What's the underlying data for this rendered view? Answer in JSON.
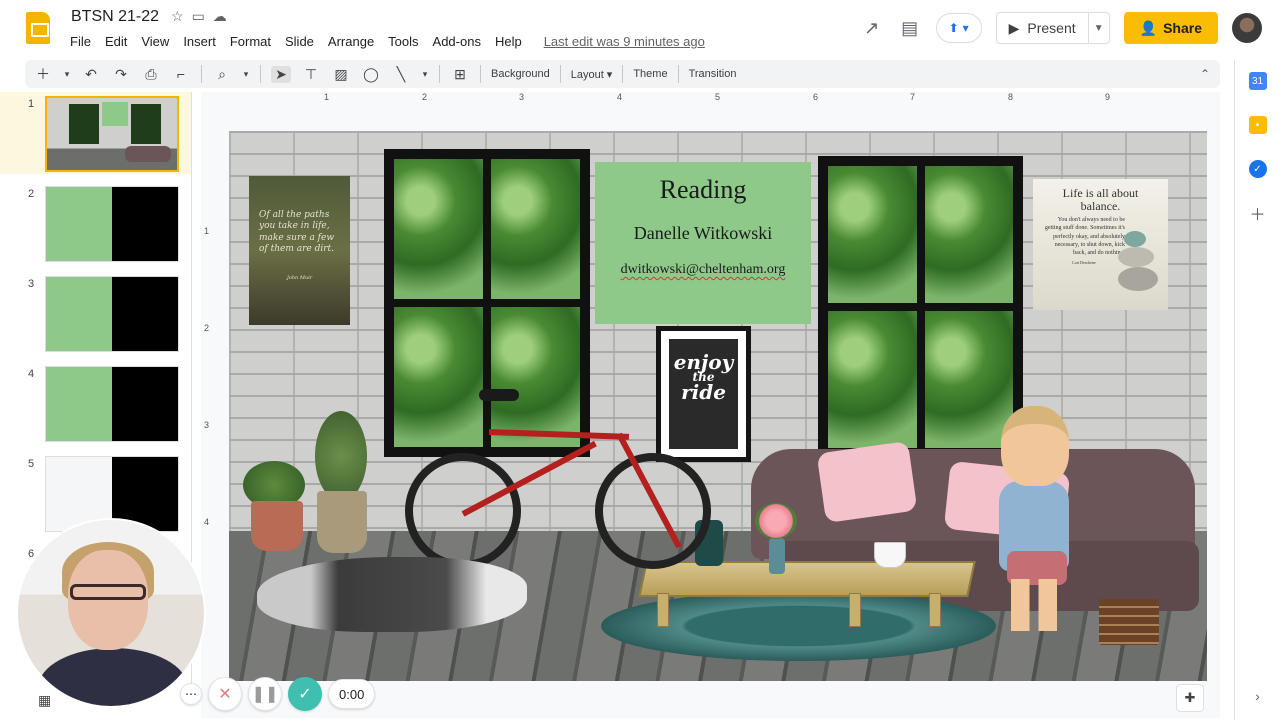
{
  "app": {
    "doc_title": "BTSN 21-22",
    "menu": [
      "File",
      "Edit",
      "View",
      "Insert",
      "Format",
      "Slide",
      "Arrange",
      "Tools",
      "Add-ons",
      "Help"
    ],
    "last_edit": "Last edit was 9 minutes ago",
    "present_label": "Present",
    "share_label": "Share"
  },
  "toolbar": {
    "background_label": "Background",
    "layout_label": "Layout",
    "theme_label": "Theme",
    "transition_label": "Transition"
  },
  "filmstrip": {
    "slide_numbers": [
      "1",
      "2",
      "3",
      "4",
      "5",
      "6"
    ],
    "selected_slide": "1"
  },
  "ruler": {
    "h_ticks": [
      "1",
      "2",
      "3",
      "4",
      "5",
      "6",
      "7",
      "8",
      "9"
    ],
    "v_ticks": [
      "1",
      "2",
      "3",
      "4"
    ]
  },
  "slide": {
    "title": "Reading",
    "name": "Danelle Witkowski",
    "email": "dwitkowski@cheltenham.org",
    "poster_left_quote": "Of all the paths you take in life, make sure a few of them are dirt.",
    "poster_left_author": "John Muir",
    "poster_right_title": "Life is all about balance.",
    "poster_right_body": "You don't always need to be getting stuff done. Sometimes it's perfectly okay, and absolutely necessary, to shut down, kick back, and do nothing.",
    "poster_right_author": "Lori Deschene",
    "frame_line1": "enjoy",
    "frame_line2": "the",
    "frame_line3": "ride"
  },
  "recorder": {
    "time": "0:00"
  },
  "colors": {
    "share_yellow": "#fbbc04",
    "slides_yellow": "#f4b400",
    "record_teal": "#3fbfb0",
    "slide_green_box": "#8ec98a"
  },
  "icons": {
    "star": "star-icon",
    "folder": "move-to-folder-icon",
    "cloud": "cloud-saved-icon",
    "trend": "activity-dashboard-icon",
    "comment": "comments-icon"
  }
}
